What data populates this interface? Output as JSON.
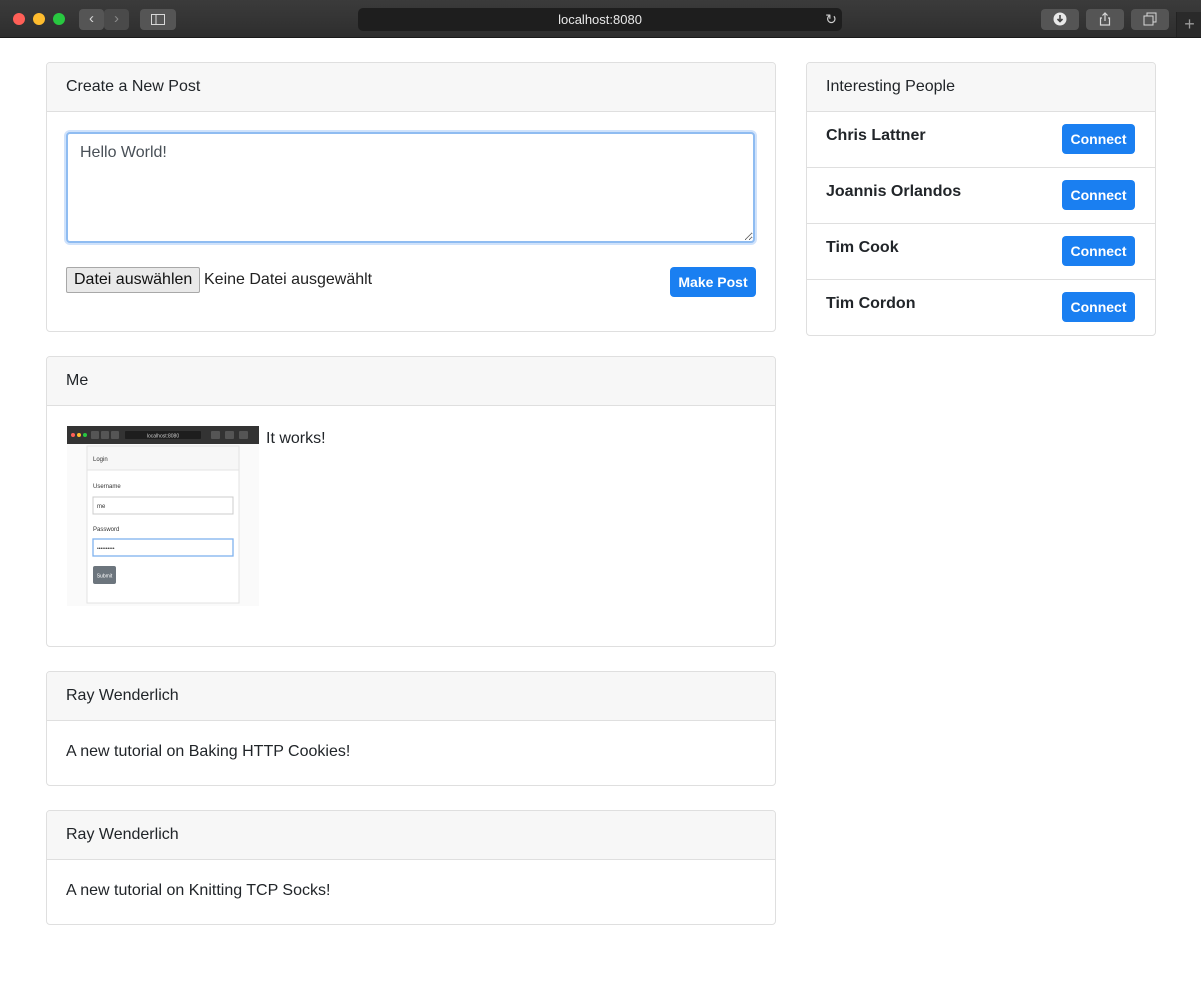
{
  "browser": {
    "url": "localhost:8080",
    "colors": {
      "close": "#ff5f57",
      "minimize": "#febc2e",
      "maximize": "#28c840"
    }
  },
  "create_post": {
    "title": "Create a New Post",
    "textarea_value": "Hello World!",
    "file_button_label": "Datei auswählen",
    "file_status": "Keine Datei ausgewählt",
    "submit_label": "Make Post"
  },
  "people": {
    "title": "Interesting People",
    "connect_label": "Connect",
    "items": [
      {
        "name": "Chris Lattner"
      },
      {
        "name": "Joannis Orlandos"
      },
      {
        "name": "Tim Cook"
      },
      {
        "name": "Tim Cordon"
      }
    ]
  },
  "posts": [
    {
      "author": "Me",
      "text": "It works!",
      "thumbnail": {
        "url": "localhost:8080",
        "title": "Login",
        "username_label": "Username",
        "username_value": "me",
        "password_label": "Password",
        "password_value": "••••••••••",
        "submit_label": "Submit"
      }
    },
    {
      "author": "Ray Wenderlich",
      "text": "A new tutorial on Baking HTTP Cookies!"
    },
    {
      "author": "Ray Wenderlich",
      "text": "A new tutorial on Knitting TCP Socks!"
    }
  ],
  "theme": {
    "accent": "#1a7ff1",
    "header_bg": "#f7f7f7",
    "border": "#dfdfdf"
  }
}
